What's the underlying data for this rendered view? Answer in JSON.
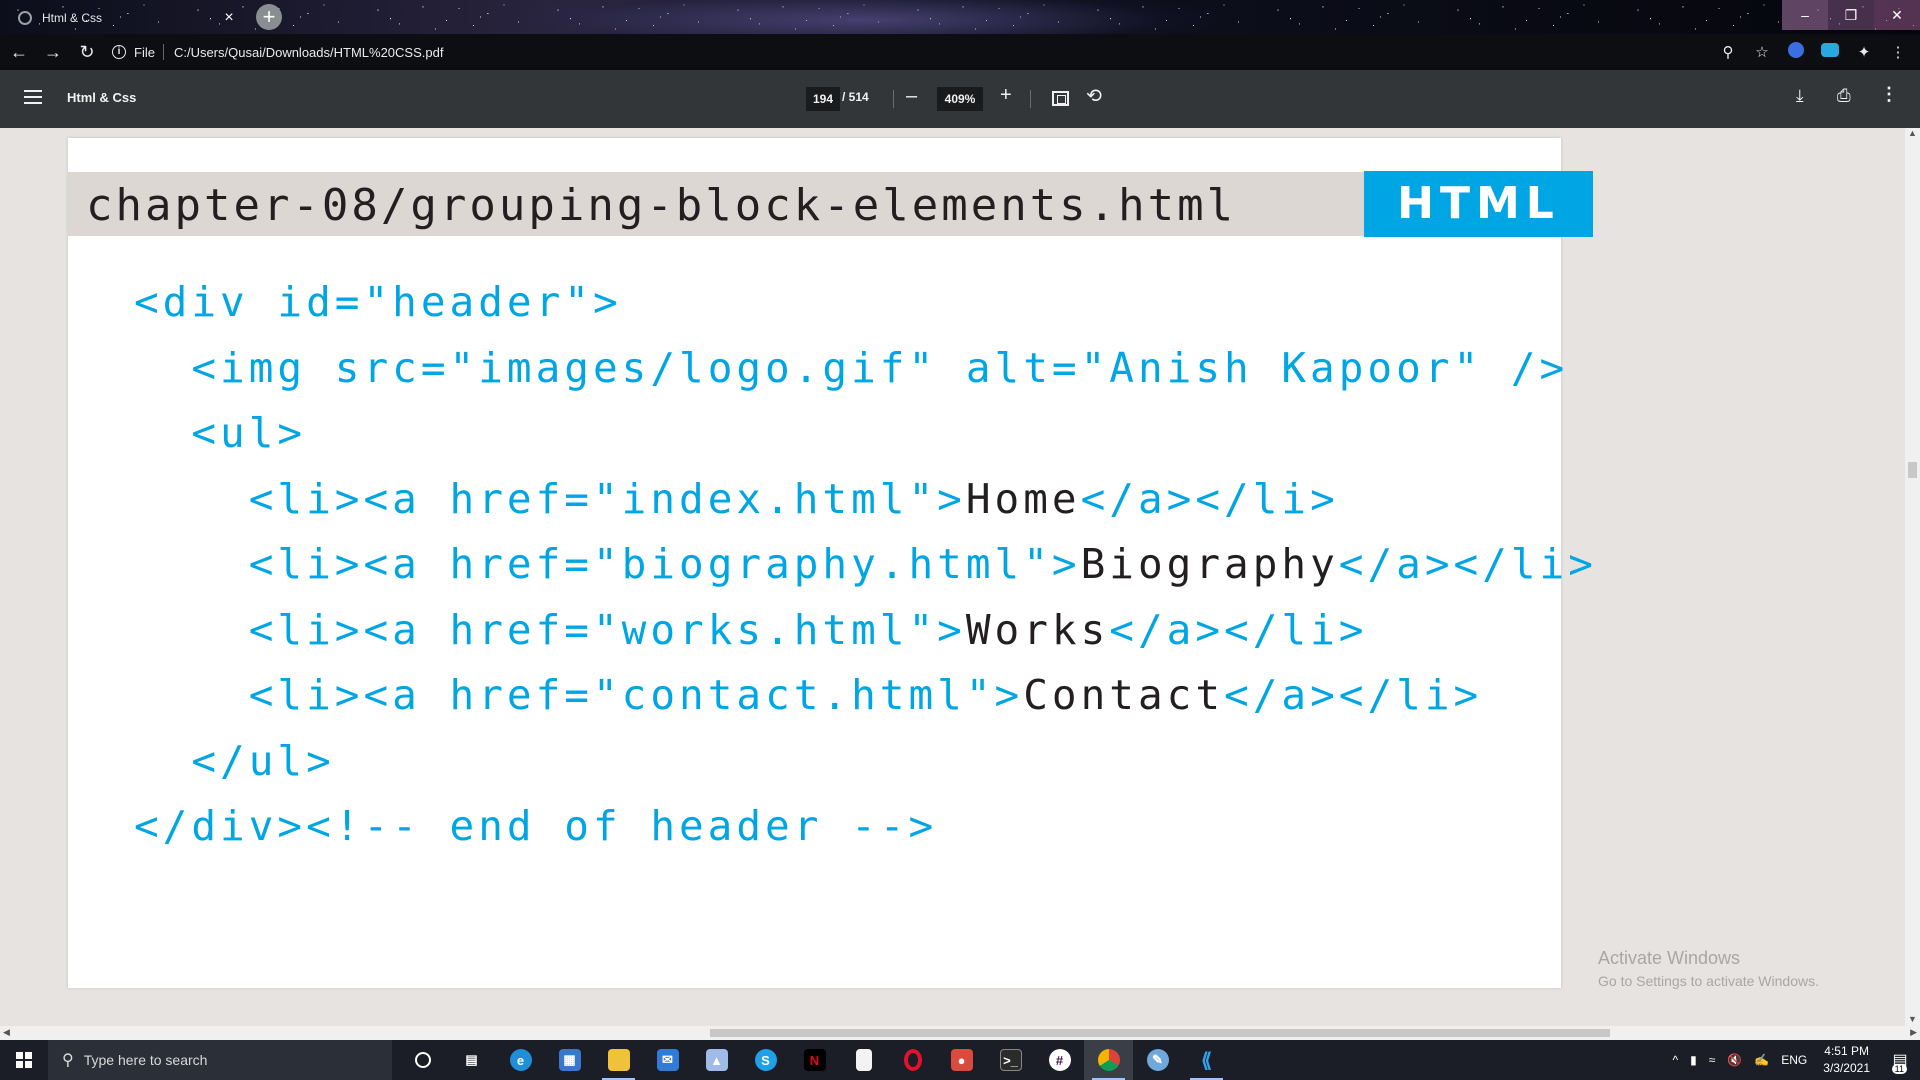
{
  "browser": {
    "tab_title": "Html & Css",
    "tab_close": "×",
    "new_tab": "+",
    "url_scheme_label": "File",
    "url": "C:/Users/Qusai/Downloads/HTML%20CSS.pdf"
  },
  "pdf_toolbar": {
    "title": "Html & Css",
    "page_current": "194",
    "page_total": "/ 514",
    "zoom": "409%",
    "zoom_out": "–",
    "zoom_in": "+"
  },
  "pdf_content": {
    "file_path": "chapter-08/grouping-block-elements.html",
    "badge": "HTML",
    "code_lines": [
      {
        "indent": "",
        "pre": "<div id=\"header\">",
        "text": "",
        "post": ""
      },
      {
        "indent": "  ",
        "pre": "<img src=\"images/logo.gif\" alt=\"Anish Kapoor\" />",
        "text": "",
        "post": ""
      },
      {
        "indent": "  ",
        "pre": "<ul>",
        "text": "",
        "post": ""
      },
      {
        "indent": "    ",
        "pre": "<li><a href=\"index.html\">",
        "text": "Home",
        "post": "</a></li>"
      },
      {
        "indent": "    ",
        "pre": "<li><a href=\"biography.html\">",
        "text": "Biography",
        "post": "</a></li>"
      },
      {
        "indent": "    ",
        "pre": "<li><a href=\"works.html\">",
        "text": "Works",
        "post": "</a></li>"
      },
      {
        "indent": "    ",
        "pre": "<li><a href=\"contact.html\">",
        "text": "Contact",
        "post": "</a></li>"
      },
      {
        "indent": "  ",
        "pre": "</ul>",
        "text": "",
        "post": ""
      },
      {
        "indent": "",
        "pre": "</div><!-- end of header -->",
        "text": "",
        "post": ""
      }
    ]
  },
  "watermark": {
    "title": "Activate Windows",
    "subtitle": "Go to Settings to activate Windows."
  },
  "taskbar": {
    "search_placeholder": "Type here to search",
    "language": "ENG",
    "time": "4:51 PM",
    "date": "3/3/2021",
    "notification_count": "11"
  },
  "colors": {
    "accent_blue": "#00a6e4",
    "code_text_dark": "#231f20",
    "banner_bg": "#dcd7d3",
    "toolbar_bg": "#323639"
  }
}
